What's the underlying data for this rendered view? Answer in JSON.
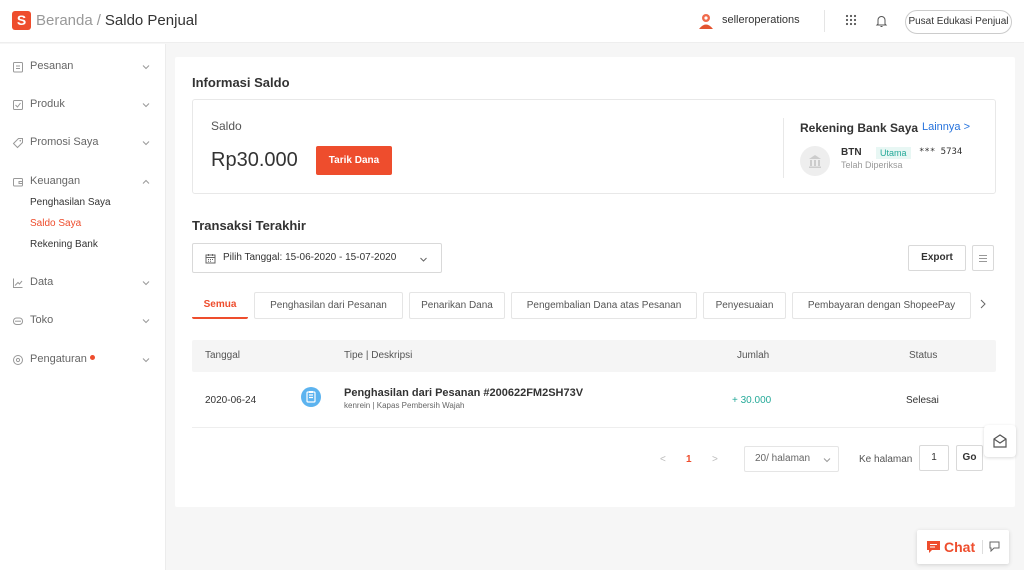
{
  "header": {
    "logo_letter": "S",
    "breadcrumb_home": "Beranda",
    "breadcrumb_sep": "/",
    "breadcrumb_current": "Saldo Penjual",
    "username": "selleroperations",
    "edu_button": "Pusat Edukasi Penjual"
  },
  "sidebar": {
    "items": [
      {
        "label": "Pesanan",
        "icon": "clipboard-icon"
      },
      {
        "label": "Produk",
        "icon": "box-icon"
      },
      {
        "label": "Promosi Saya",
        "icon": "tag-icon"
      },
      {
        "label": "Keuangan",
        "icon": "wallet-icon"
      },
      {
        "label": "Data",
        "icon": "chart-icon"
      },
      {
        "label": "Toko",
        "icon": "store-icon"
      },
      {
        "label": "Pengaturan",
        "icon": "settings-icon"
      }
    ],
    "keuangan_sub": [
      "Penghasilan Saya",
      "Saldo Saya",
      "Rekening Bank"
    ]
  },
  "saldo": {
    "section_title": "Informasi Saldo",
    "label": "Saldo",
    "amount": "Rp30.000",
    "withdraw_button": "Tarik Dana",
    "bank_title": "Rekening Bank Saya",
    "bank_more": "Lainnya >",
    "bank_name": "BTN",
    "bank_badge": "Utama",
    "bank_number": "*** 5734",
    "bank_status": "Telah Diperiksa"
  },
  "transactions": {
    "title": "Transaksi Terakhir",
    "date_filter": "Pilih Tanggal: 15-06-2020 - 15-07-2020",
    "export_button": "Export",
    "tabs": [
      "Semua",
      "Penghasilan dari Pesanan",
      "Penarikan Dana",
      "Pengembalian Dana atas Pesanan",
      "Penyesuaian",
      "Pembayaran dengan ShopeePay"
    ],
    "columns": [
      "Tanggal",
      "Tipe | Deskripsi",
      "Jumlah",
      "Status"
    ],
    "rows": [
      {
        "date": "2020-06-24",
        "title": "Penghasilan dari Pesanan #200622FM2SH73V",
        "desc": "kenrein | Kapas Pembersih Wajah",
        "amount": "+ 30.000",
        "status": "Selesai"
      }
    ]
  },
  "pagination": {
    "prev": "<",
    "current_page": "1",
    "next": ">",
    "per_page": "20/ halaman",
    "goto_label": "Ke halaman",
    "goto_value": "1",
    "go_button": "Go"
  },
  "chat": {
    "label": "Chat"
  },
  "colors": {
    "accent": "#ee4d2d",
    "positive": "#26aa99",
    "link": "#2673dd"
  }
}
